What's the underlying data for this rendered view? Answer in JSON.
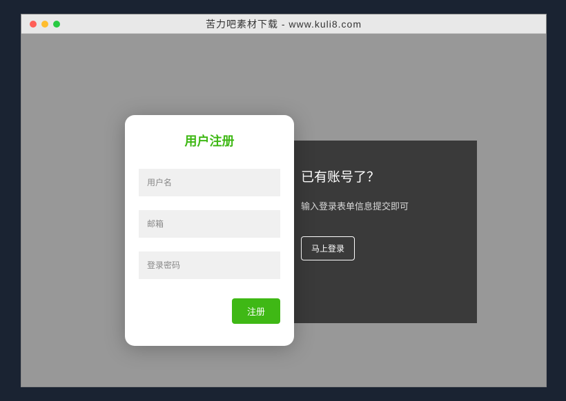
{
  "window": {
    "title": "苦力吧素材下载 - www.kuli8.com"
  },
  "register": {
    "title": "用户注册",
    "username_placeholder": "用户名",
    "email_placeholder": "邮箱",
    "password_placeholder": "登录密码",
    "submit_label": "注册"
  },
  "side_panel": {
    "heading": "已有账号了？",
    "description": "输入登录表单信息提交即可",
    "button_label": "马上登录"
  }
}
